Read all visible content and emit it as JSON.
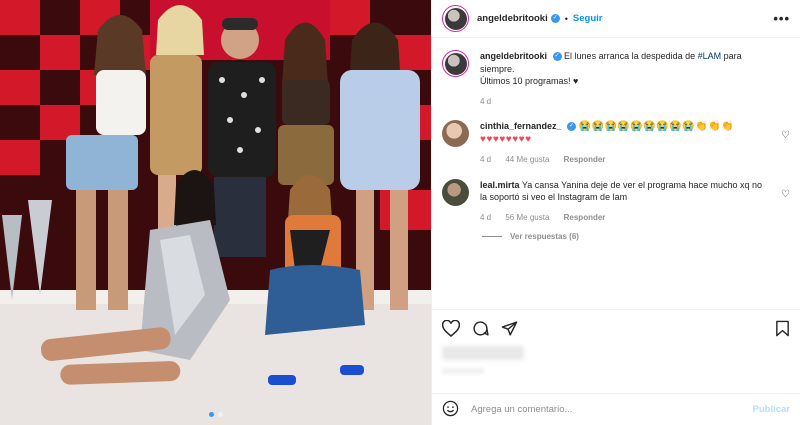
{
  "post": {
    "username": "angeldebritooki",
    "verified_glyph": "✓",
    "separator": "•",
    "follow_label": "Seguir",
    "more_label": "•••"
  },
  "caption": {
    "username": "angeldebritooki",
    "text_before": "El lunes arranca la despedida de ",
    "hashtag": "#LAM",
    "text_after": " para siempre.",
    "line2": "Últimos 10 programas! ♥",
    "time": "4 d"
  },
  "comments": [
    {
      "username": "cinthia_fernandez_",
      "emojis_1": "😭😭😭😭😭😭😭😭😭👏👏👏",
      "emojis_2": "♥♥♥♥♥♥♥♥",
      "time": "4 d",
      "likes": "44 Me gusta",
      "reply": "Responder",
      "heart": "♡"
    },
    {
      "username": "leal.mirta",
      "text": "Ya cansa Yanina deje de ver el programa hace mucho xq no la soportó si veo el Instagram de lam",
      "time": "4 d",
      "likes": "56 Me gusta",
      "reply": "Responder",
      "heart": "♡",
      "view_replies": "Ver respuestas (6)"
    }
  ],
  "add_comment": {
    "placeholder": "Agrega un comentario...",
    "publish_label": "Publicar"
  },
  "icons": [
    "more-icon",
    "heart-icon",
    "comment-icon",
    "share-icon",
    "save-icon",
    "emoji-icon",
    "verified-icon"
  ],
  "colors": {
    "accent": "#0095f6",
    "publish_disabled": "#b2dffc",
    "muted": "#8e8e8e",
    "hashtag": "#00376b",
    "heart_red": "#ed4956"
  },
  "carousel": {
    "slides": 2,
    "active": 0
  }
}
